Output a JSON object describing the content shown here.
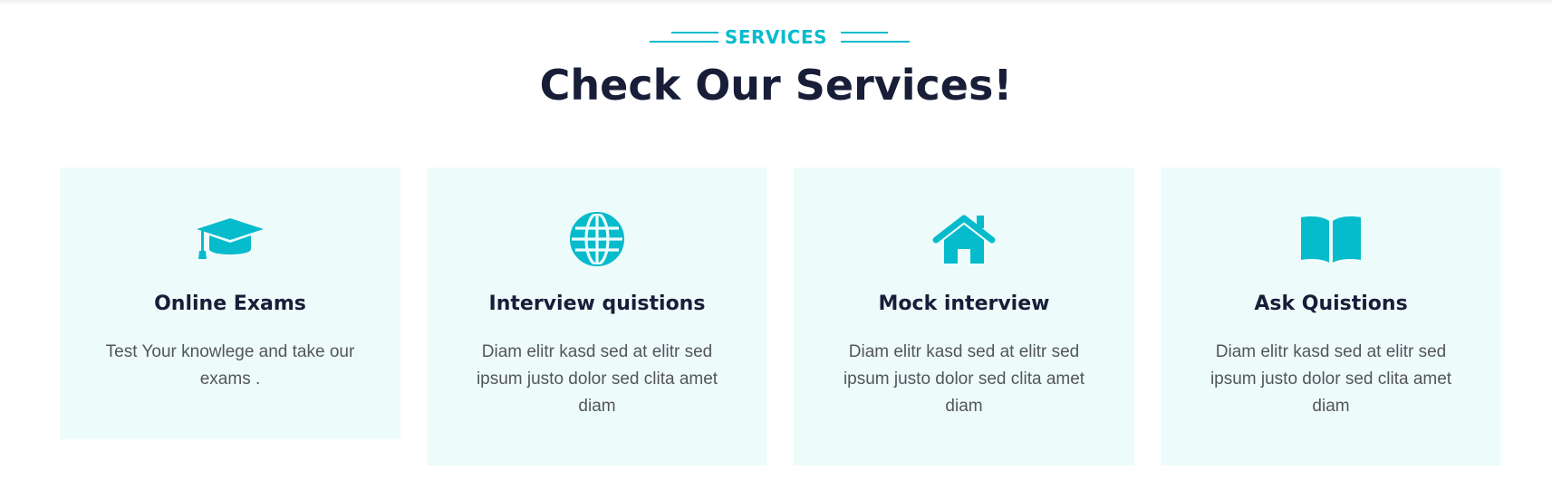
{
  "section": {
    "eyebrow": "SERVICES",
    "title": "Check Our Services!"
  },
  "accent_color": "#06bbcc",
  "card_background": "#eefbfb",
  "services": [
    {
      "icon": "graduation-cap-icon",
      "title": "Online Exams",
      "text": "Test Your knowlege and take our exams ."
    },
    {
      "icon": "globe-icon",
      "title": "Interview quistions",
      "text": "Diam elitr kasd sed at elitr sed ipsum justo dolor sed clita amet diam"
    },
    {
      "icon": "home-icon",
      "title": "Mock interview",
      "text": "Diam elitr kasd sed at elitr sed ipsum justo dolor sed clita amet diam"
    },
    {
      "icon": "book-open-icon",
      "title": "Ask Quistions",
      "text": "Diam elitr kasd sed at elitr sed ipsum justo dolor sed clita amet diam"
    }
  ]
}
